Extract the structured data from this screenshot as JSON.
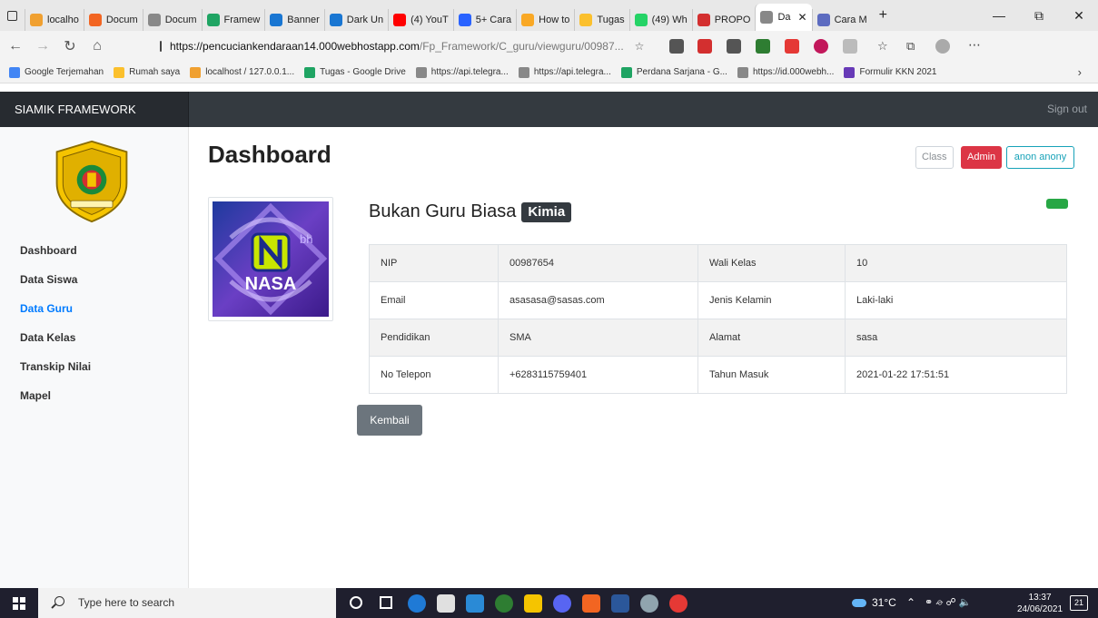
{
  "browser": {
    "tabs": [
      {
        "label": "localho",
        "color": "#f0a030"
      },
      {
        "label": "Docum",
        "color": "#f26522"
      },
      {
        "label": "Docum",
        "color": "#888888"
      },
      {
        "label": "Framew",
        "color": "#1fa463"
      },
      {
        "label": "Banner",
        "color": "#1976d2"
      },
      {
        "label": "Dark Un",
        "color": "#1976d2"
      },
      {
        "label": "(4) YouT",
        "color": "#ff0000"
      },
      {
        "label": "5+ Cara",
        "color": "#2962ff"
      },
      {
        "label": "How to",
        "color": "#f9a825"
      },
      {
        "label": "Tugas",
        "color": "#fbc02d"
      },
      {
        "label": "(49) Wh",
        "color": "#25d366"
      },
      {
        "label": "PROPO",
        "color": "#d32f2f"
      },
      {
        "label": "Da",
        "color": "#888888"
      },
      {
        "label": "Cara M",
        "color": "#5c6bc0"
      }
    ],
    "new_tab": "+",
    "url_host": "https://pencuciankendaraan14.000webhostapp.com",
    "url_path": "/Fp_Framework/C_guru/viewguru/00987...",
    "bookmarks": [
      {
        "label": "Google Terjemahan",
        "color": "#4285f4"
      },
      {
        "label": "Rumah saya",
        "color": "#fbc02d"
      },
      {
        "label": "localhost / 127.0.0.1...",
        "color": "#f0a030"
      },
      {
        "label": "Tugas - Google Drive",
        "color": "#1fa463"
      },
      {
        "label": "https://api.telegra...",
        "color": "#888888"
      },
      {
        "label": "https://api.telegra...",
        "color": "#888888"
      },
      {
        "label": "Perdana Sarjana - G...",
        "color": "#1fa463"
      },
      {
        "label": "https://id.000webh...",
        "color": "#888888"
      },
      {
        "label": "Formulir KKN 2021",
        "color": "#673ab7"
      }
    ]
  },
  "app": {
    "brand": "SIAMIK FRAMEWORK",
    "sign_out": "Sign out"
  },
  "sidebar": {
    "items": [
      {
        "label": "Dashboard",
        "active": false
      },
      {
        "label": "Data Siswa",
        "active": false
      },
      {
        "label": "Data Guru",
        "active": true
      },
      {
        "label": "Data Kelas",
        "active": false
      },
      {
        "label": "Transkip Nilai",
        "active": false
      },
      {
        "label": "Mapel",
        "active": false
      }
    ]
  },
  "main": {
    "title": "Dashboard",
    "badge_class": "Class",
    "badge_admin": "Admin",
    "user_button": "anon anony",
    "photo_text_top": "bh",
    "photo_text": "NASA",
    "teacher_name": "Bukan Guru Biasa",
    "subject": "Kimia",
    "table": [
      [
        "NIP",
        "00987654",
        "Wali Kelas",
        "10"
      ],
      [
        "Email",
        "asasasa@sasas.com",
        "Jenis Kelamin",
        "Laki-laki"
      ],
      [
        "Pendidikan",
        "SMA",
        "Alamat",
        "sasa"
      ],
      [
        "No Telepon",
        "+6283115759401",
        "Tahun Masuk",
        "2021-01-22 17:51:51"
      ]
    ],
    "back_button": "Kembali"
  },
  "taskbar": {
    "search_placeholder": "Type here to search",
    "weather": "31°C",
    "time": "13:37",
    "date": "24/06/2021",
    "notifications": "21"
  },
  "colors": {
    "header": "#343a40",
    "active_link": "#007bff",
    "admin": "#dc3545",
    "user_outline": "#17a2b8",
    "status": "#28a745"
  }
}
